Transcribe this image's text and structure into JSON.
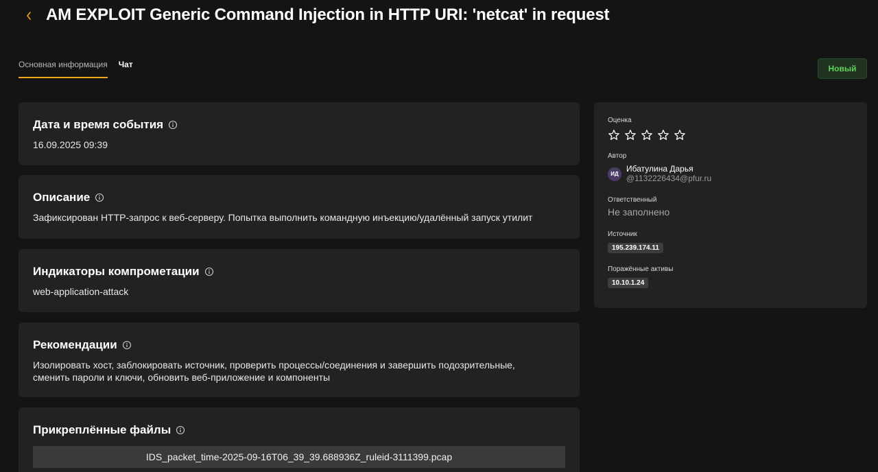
{
  "header": {
    "title": "AM EXPLOIT Generic Command Injection in HTTP URI: 'netcat' in request"
  },
  "tabs": [
    {
      "label": "Основная информация",
      "active": true
    },
    {
      "label": "Чат",
      "active": false
    }
  ],
  "status": {
    "label": "Новый",
    "color": "#5fd35b"
  },
  "colors": {
    "accent": "#f2a516",
    "card_bg": "#222222",
    "page_bg": "#141414"
  },
  "cards": {
    "datetime": {
      "title": "Дата и время события",
      "value": "16.09.2025 09:39"
    },
    "description": {
      "title": "Описание",
      "value": "Зафиксирован HTTP-запрос к веб-серверу. Попытка выполнить командную инъекцию/удалённый запуск утилит"
    },
    "indicators": {
      "title": "Индикаторы компрометации",
      "value": "web-application-attack"
    },
    "recommendations": {
      "title": "Рекомендации",
      "value": "Изолировать хост, заблокировать источник, проверить процессы/соединения и завершить подозрительные, сменить пароли и ключи, обновить веб-приложение и компоненты"
    },
    "files": {
      "title": "Прикреплённые файлы",
      "items": [
        "IDS_packet_time-2025-09-16T06_39_39.688936Z_ruleid-3111399.pcap"
      ]
    }
  },
  "side": {
    "rating": {
      "label": "Оценка",
      "value": 0,
      "max": 5
    },
    "author": {
      "label": "Автор",
      "initials": "ИД",
      "name": "Ибатулина Дарья",
      "login": "@1132226434@pfur.ru"
    },
    "responsible": {
      "label": "Ответственный",
      "value": "Не заполнено"
    },
    "source": {
      "label": "Источник",
      "value": "195.239.174.11"
    },
    "assets": {
      "label": "Поражённые активы",
      "value": "10.10.1.24"
    }
  }
}
